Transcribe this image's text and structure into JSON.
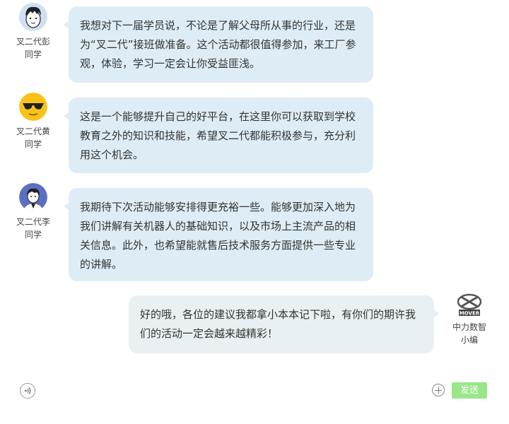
{
  "messages": [
    {
      "name": "叉二代彭\n同学",
      "text": "我想对下一届学员说，不论是了解父母所从事的行业，还是为“叉二代”接班做准备。这个活动都很值得参加，来工厂参观，体验，学习一定会让你受益匪浅。",
      "avatar": "boy-cartoon-icon"
    },
    {
      "name": "叉二代黄\n同学",
      "text": "这是一个能够提升自己的好平台，在这里你可以获取到学校教育之外的知识和技能，希望叉二代都能积极参与，充分利用这个机会。",
      "avatar": "sunglasses-emoji-icon"
    },
    {
      "name": "叉二代李\n同学",
      "text": "我期待下次活动能够安排得更充裕一些。能够更加深入地为我们讲解有关机器人的基础知识，以及市场上主流产品的相关信息。此外，也希望能就售后技术服务方面提供一些专业的讲解。",
      "avatar": "boy-suit-icon"
    },
    {
      "name": "中力数智\n小编",
      "text": "好的哦，各位的建议我都拿小本本记下啦，有你们的期许我们的活动一定会越来越精彩！",
      "avatar": "mover-logo-icon",
      "logo_text": "MOVER"
    }
  ],
  "input_bar": {
    "send_label": "发送",
    "voice_icon": "voice-icon",
    "plus_icon": "plus-icon",
    "send_color": "#9ae68a"
  }
}
